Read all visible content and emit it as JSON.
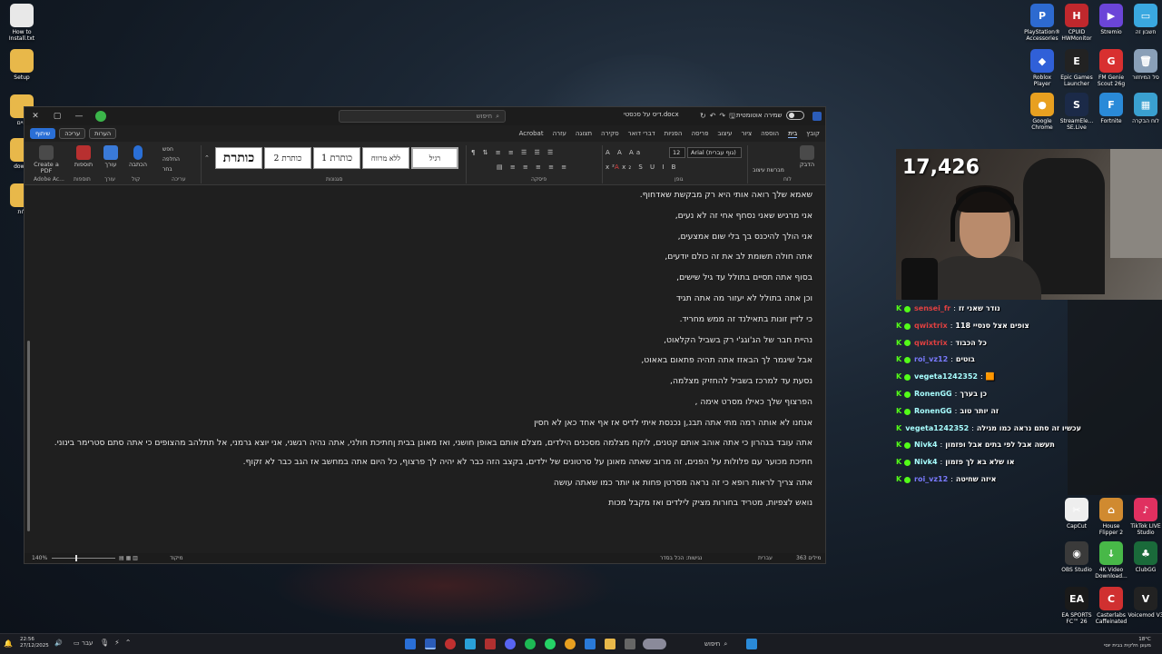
{
  "desktop": {
    "left_icons": [
      {
        "label": "How to Install.txt",
        "icon": "text-file-icon",
        "color": "#e8e8e8"
      },
      {
        "label": "Setup",
        "icon": "folder-icon",
        "color": "#e8b84a"
      },
      {
        "label": "חיים",
        "icon": "folder-icon",
        "color": "#e8b84a"
      },
      {
        "label": "downl",
        "icon": "folder-icon",
        "color": "#e8b84a"
      },
      {
        "label": "לות",
        "icon": "folder-icon",
        "color": "#e8b84a"
      }
    ],
    "right_icons": [
      {
        "label": "PlayStation® Accessories",
        "icon": "playstation-icon",
        "color": "#2d6ad0",
        "glyph": "P"
      },
      {
        "label": "CPUID HWMonitor",
        "icon": "hwmonitor-icon",
        "color": "#c0282d",
        "glyph": "H"
      },
      {
        "label": "Stremio",
        "icon": "stremio-icon",
        "color": "#6b45d8",
        "glyph": "▶"
      },
      {
        "label": "חשבון זה",
        "icon": "pc-icon",
        "color": "#3aa8e0",
        "glyph": "▭"
      },
      {
        "label": "Roblox Player",
        "icon": "roblox-icon",
        "color": "#3060d8",
        "glyph": "◆"
      },
      {
        "label": "Epic Games Launcher",
        "icon": "epic-games-icon",
        "color": "#222222",
        "glyph": "E"
      },
      {
        "label": "FM Genie Scout 26g",
        "icon": "fm-genie-icon",
        "color": "#d83030",
        "glyph": "G"
      },
      {
        "label": "סל המיחזור",
        "icon": "recycle-bin-icon",
        "color": "#8aa0b8",
        "glyph": "🗑"
      },
      {
        "label": "Google Chrome",
        "icon": "chrome-icon",
        "color": "#e8a020",
        "glyph": "●"
      },
      {
        "label": "StreamEle... SE.Live",
        "icon": "streamelements-icon",
        "color": "#1b2a48",
        "glyph": "S"
      },
      {
        "label": "Fortnite",
        "icon": "fortnite-icon",
        "color": "#2a8ad8",
        "glyph": "F"
      },
      {
        "label": "לוח הבקרה",
        "icon": "control-panel-icon",
        "color": "#3aa0d0",
        "glyph": "▦"
      },
      {
        "label": "CapCut",
        "icon": "capcut-icon",
        "color": "#eeeeee",
        "glyph": "✂"
      },
      {
        "label": "House Flipper 2",
        "icon": "house-flipper-icon",
        "color": "#d08a30",
        "glyph": "⌂"
      },
      {
        "label": "TikTok LIVE Studio",
        "icon": "tiktok-icon",
        "color": "#e03060",
        "glyph": "♪"
      },
      {
        "label": "OBS Studio",
        "icon": "obs-icon",
        "color": "#3a3a3a",
        "glyph": "◉"
      },
      {
        "label": "4K Video Download...",
        "icon": "4k-video-icon",
        "color": "#48b848",
        "glyph": "↓"
      },
      {
        "label": "ClubGG",
        "icon": "clubgg-icon",
        "color": "#1a6a3a",
        "glyph": "♣"
      },
      {
        "label": "EA SPORTS FC™ 26",
        "icon": "ea-fc-icon",
        "color": "#1a1a1a",
        "glyph": "EA"
      },
      {
        "label": "Casterlabs Caffeinated",
        "icon": "casterlabs-icon",
        "color": "#d03030",
        "glyph": "C"
      },
      {
        "label": "Voicemod V3",
        "icon": "voicemod-icon",
        "color": "#222222",
        "glyph": "V"
      }
    ]
  },
  "word": {
    "title_doc": "דיס על סכסטי.docx",
    "autosave_label": "שמירה אוטומטית",
    "search_placeholder": "חיפוש",
    "tabs": [
      "קובץ",
      "בית",
      "הוספה",
      "ציור",
      "עיצוב",
      "פריסה",
      "הפניות",
      "דברי דואר",
      "סקירה",
      "תצוגה",
      "עזרה",
      "Acrobat"
    ],
    "active_tab": "בית",
    "tab_buttons": {
      "comments": "הערות",
      "editing": "עריכה",
      "share": "שיתוף"
    },
    "ribbon": {
      "group_labels": {
        "clipboard": "לוח",
        "font": "גופן",
        "paragraph": "פיסקה",
        "styles": "סגנונות",
        "editing": "עריכה",
        "voice": "קול",
        "editor": "עורך",
        "addins": "תוספות",
        "adobe": "Adobe Ac..."
      },
      "font_name": "Arial (גוף עברית)",
      "font_size": "12",
      "styles": [
        "רגיל",
        "ללא מרווח",
        "כותרת 1",
        "כותרת 2",
        "כותרת"
      ],
      "paste_label": "הדבק",
      "format_painter": "מברשת עיצוב",
      "editing_items": [
        "חפש",
        "החלפה",
        "בחר"
      ],
      "tools": [
        "הכתבה",
        "עורך",
        "תוספות",
        "Create a PDF"
      ]
    },
    "doc_lines": [
      "שאמא שלך רואה אותי היא רק מבקשת שאדחוף.",
      "אני מרגיש שאני נסחף אחי זה לא נעים,",
      "אני הולך להיכנס בך בלי שום אמצעים,",
      "אתה חולה תשומת לב את זה כולם יודעים,",
      "בסוף אתה תסיים בתולל עד גיל שישים,",
      "וכן אתה בתולל לא יעזור מה אתה תגיד",
      "כי לזיין זונות בתאילנד זה ממש מחריד.",
      "נהיית חבר של הג'וגג'י רק בשביל הקלאוט,",
      "אבל שיגמר לך הבאזז אתה תהיה פתאום באאוט,",
      " נסעת עד למרכז בשביל להחזיק מצלמה,",
      "הפרצוף שלך כאילו מסרט אימה ,",
      "אנחנו לא אותה רמה מתי אתה תבנ,ן נכנסת איתי לדיס אז אף אחד כאן לא חסין",
      "אתה עובד בגהרון כי אתה אוהב אותם קטנים, לוקח מצלמה מסכנים הילדים, מצלם אותם באופן חושני, ואז מאונן בבית ןחתיכת חולני, אתה נהיה רגשני, אני יוצא גרמני, אל תתלהב מהצופים כי אתה סתם סטרימר בינוני.",
      "חתיכת מכוער עם פלולות על הפנים, זה מרוב שאתה מאונן על סרטונים של ילדים, בקצב הזה כבר לא יהיה לך פרצוף, כל היום אתה במחשב אז הגב כבר לא זקוף.",
      "אתה צריך לראות רופא כי זה נראה מסרטן פחות או יותר כמו שאתה עושה",
      "נואש לצפיות, מטריד בחורות מציק לילדים ואז מקבל מכות"
    ],
    "status": {
      "zoom": "140%",
      "focus": "מיקוד",
      "words": "363 מילים",
      "language": "עברית",
      "accessibility": "נגישות: הכל בסדר"
    }
  },
  "stream": {
    "viewer_count": "17,426",
    "chat": [
      {
        "user": "sensei_fr",
        "user_color": "#e04040",
        "msg": "נודר שאני זז"
      },
      {
        "user": "qwixtrix",
        "user_color": "#e04040",
        "msg": "צופים אצל סנסיי 118"
      },
      {
        "user": "qwixtrix",
        "user_color": "#e04040",
        "msg": "כל הכבוד"
      },
      {
        "user": "roi_vz12",
        "user_color": "#7a7aff",
        "msg": "בוטים"
      },
      {
        "user": "vegeta1242352",
        "user_color": "#a8ffff",
        "msg": "🟧"
      },
      {
        "user": "RonenGG",
        "user_color": "#a8ffff",
        "msg": "כן בערך"
      },
      {
        "user": "RonenGG",
        "user_color": "#a8ffff",
        "msg": "זה יותר טוב"
      },
      {
        "user": "vegeta1242352",
        "user_color": "#a8ffff",
        "msg": "עכשיו זה סתם נראה כמו מגילה"
      },
      {
        "user": "Nivk4",
        "user_color": "#a8ffff",
        "msg": "תעשה אבל לפי בתים אבל ופזמון"
      },
      {
        "user": "Nivk4",
        "user_color": "#a8ffff",
        "msg": "או שלא בא לך פזמון"
      },
      {
        "user": "roi_vz12",
        "user_color": "#7a7aff",
        "msg": "איזה שחיטה"
      }
    ]
  },
  "taskbar": {
    "time": "22:56",
    "date": "27/12/2025",
    "lang": "עבר",
    "search": "חיפוש",
    "weather_temp": "18°C",
    "weather_desc": "מעונן חלקית בבית יוסי"
  }
}
